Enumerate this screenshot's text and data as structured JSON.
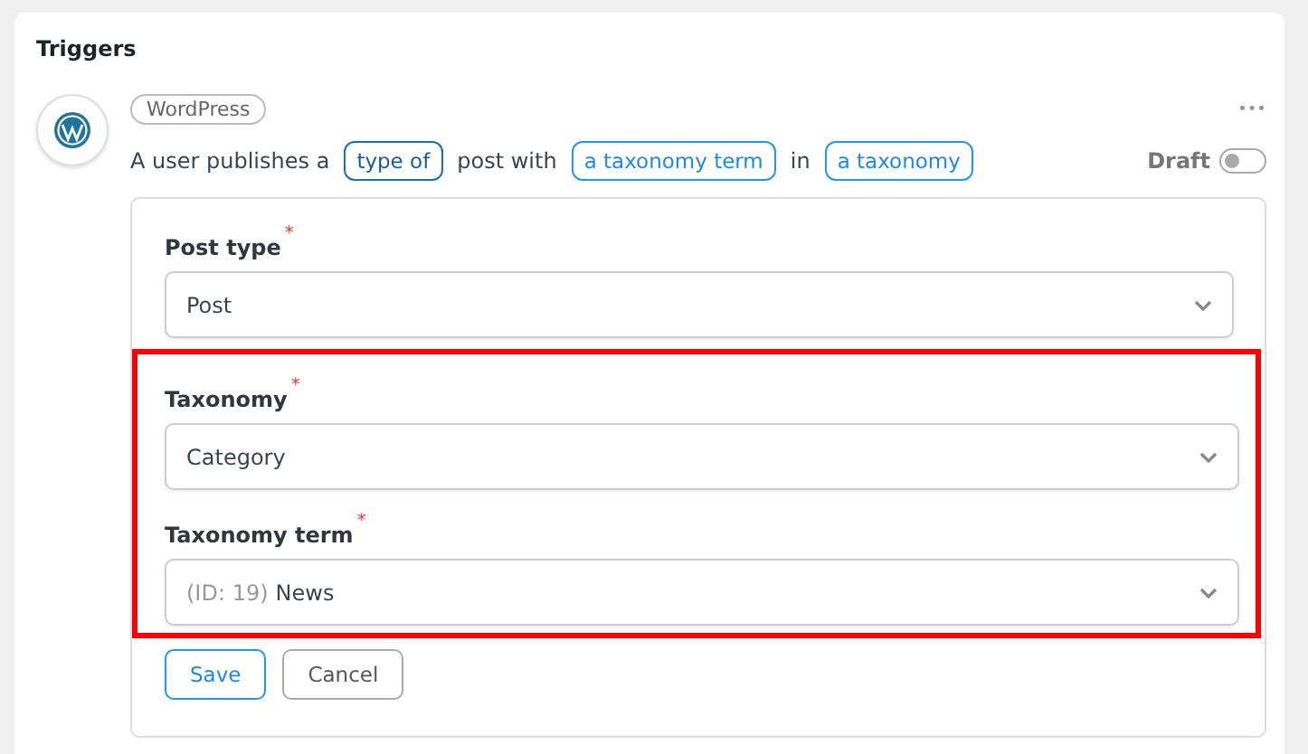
{
  "panel": {
    "title": "Triggers"
  },
  "trigger": {
    "app_tag": "WordPress",
    "more": "•••",
    "sentence": [
      {
        "kind": "text",
        "text": "A user publishes a"
      },
      {
        "kind": "chip",
        "text": "type of",
        "selected": true
      },
      {
        "kind": "text",
        "text": "post with"
      },
      {
        "kind": "chip",
        "text": "a taxonomy term",
        "selected": false
      },
      {
        "kind": "text",
        "text": "in"
      },
      {
        "kind": "chip",
        "text": "a taxonomy",
        "selected": false
      }
    ],
    "draft": {
      "label": "Draft",
      "on": false
    }
  },
  "form": {
    "fields": [
      {
        "label": "Post type",
        "marker": "*",
        "value": "Post",
        "highlighted": false
      },
      {
        "label": "Taxonomy",
        "marker": "*",
        "value": "Category",
        "highlighted": true
      },
      {
        "label": "Taxonomy term",
        "marker": "*",
        "prefix": "(ID: 19)",
        "value": "News",
        "highlighted": true
      }
    ],
    "buttons": [
      {
        "kind": "primary",
        "label": "Save"
      },
      {
        "kind": "secondary",
        "label": "Cancel"
      }
    ]
  }
}
